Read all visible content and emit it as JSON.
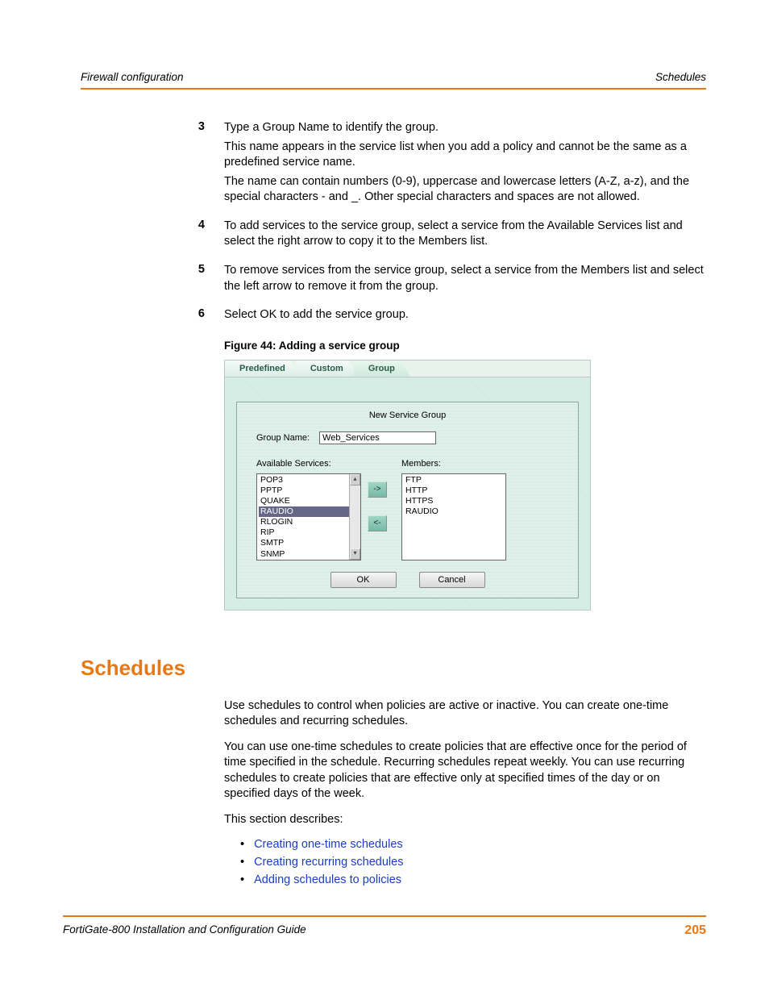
{
  "header": {
    "left": "Firewall configuration",
    "right": "Schedules"
  },
  "steps": [
    {
      "num": "3",
      "paras": [
        "Type a Group Name to identify the group.",
        "This name appears in the service list when you add a policy and cannot be the same as a predefined service name.",
        "The name can contain numbers (0-9), uppercase and lowercase letters (A-Z, a-z), and the special characters - and _. Other special characters and spaces are not allowed."
      ]
    },
    {
      "num": "4",
      "paras": [
        "To add services to the service group, select a service from the Available Services list and select the right arrow to copy it to the Members list."
      ]
    },
    {
      "num": "5",
      "paras": [
        "To remove services from the service group, select a service from the Members list and select the left arrow to remove it from the group."
      ]
    },
    {
      "num": "6",
      "paras": [
        "Select OK to add the service group."
      ]
    }
  ],
  "figure": {
    "caption": "Figure 44: Adding a service group",
    "tabs": [
      "Predefined",
      "Custom",
      "Group"
    ],
    "active_tab_index": 2,
    "panel_title": "New Service Group",
    "group_name_label": "Group Name:",
    "group_name_value": "Web_Services",
    "available_label": "Available Services:",
    "available_items": [
      "POP3",
      "PPTP",
      "QUAKE",
      "RAUDIO",
      "RLOGIN",
      "RIP",
      "SMTP",
      "SNMP"
    ],
    "available_selected_index": 3,
    "members_label": "Members:",
    "members_items": [
      "FTP",
      "HTTP",
      "HTTPS",
      "RAUDIO"
    ],
    "arrow_right": "->",
    "arrow_left": "<-",
    "ok_label": "OK",
    "cancel_label": "Cancel"
  },
  "section_heading": "Schedules",
  "paragraphs": [
    "Use schedules to control when policies are active or inactive. You can create one-time schedules and recurring schedules.",
    "You can use one-time schedules to create policies that are effective once for the period of time specified in the schedule. Recurring schedules repeat weekly. You can use recurring schedules to create policies that are effective only at specified times of the day or on specified days of the week.",
    "This section describes:"
  ],
  "bullet_links": [
    "Creating one-time schedules",
    "Creating recurring schedules",
    "Adding schedules to policies"
  ],
  "footer": {
    "left": "FortiGate-800 Installation and Configuration Guide",
    "page": "205"
  }
}
